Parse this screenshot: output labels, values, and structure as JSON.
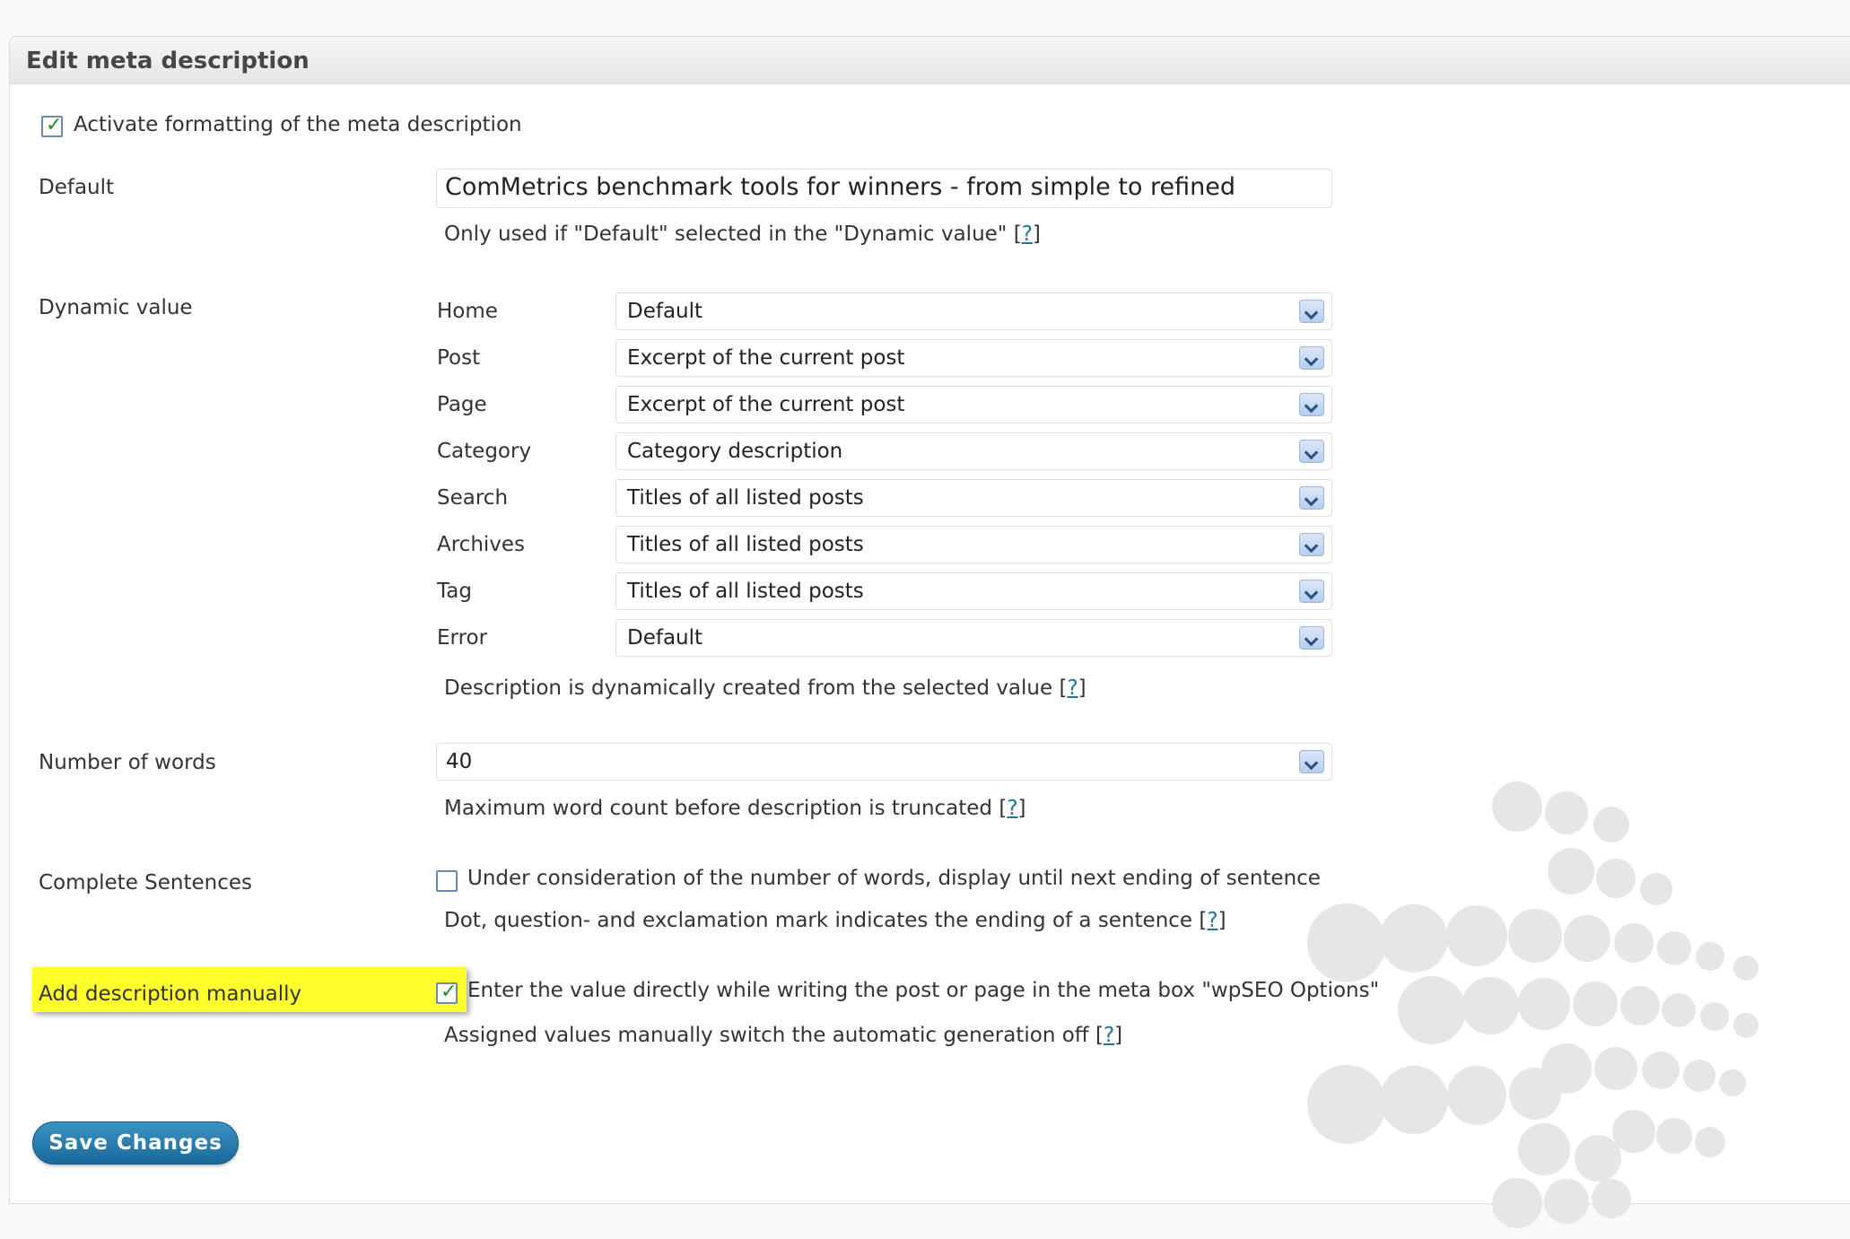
{
  "panel": {
    "title": "Edit meta description"
  },
  "activate": {
    "label": "Activate formatting of the meta description",
    "checked": true
  },
  "default_field": {
    "label": "Default",
    "value": "ComMetrics  benchmark tools for winners - from simple to refined",
    "note": "Only used if \"Default\" selected in the \"Dynamic value\"",
    "help": "?"
  },
  "dynamic": {
    "label": "Dynamic value",
    "rows": [
      {
        "label": "Home",
        "value": "Default"
      },
      {
        "label": "Post",
        "value": "Excerpt of the current post"
      },
      {
        "label": "Page",
        "value": "Excerpt of the current post"
      },
      {
        "label": "Category",
        "value": "Category description"
      },
      {
        "label": "Search",
        "value": "Titles of all listed posts"
      },
      {
        "label": "Archives",
        "value": "Titles of all listed posts"
      },
      {
        "label": "Tag",
        "value": "Titles of all listed posts"
      },
      {
        "label": "Error",
        "value": "Default"
      }
    ],
    "note": "Description is dynamically created from the selected value",
    "help": "?"
  },
  "words": {
    "label": "Number of words",
    "value": "40",
    "note": "Maximum word count before description is truncated",
    "help": "?"
  },
  "sentences": {
    "label": "Complete Sentences",
    "checkbox_label": "Under consideration of the number of words, display until next ending of sentence",
    "checked": false,
    "note": "Dot, question- and exclamation mark indicates the ending of a sentence",
    "help": "?"
  },
  "manual": {
    "label": "Add description manually",
    "checkbox_label": "Enter the value directly while writing the post or page in the meta box \"wpSEO Options\"",
    "checked": true,
    "note": "Assigned values manually switch the automatic generation off",
    "help": "?"
  },
  "save": {
    "label": "Save Changes"
  },
  "colors": {
    "accent": "#21759b",
    "button": "#1a6a9b",
    "highlight": "#ffff2b"
  }
}
